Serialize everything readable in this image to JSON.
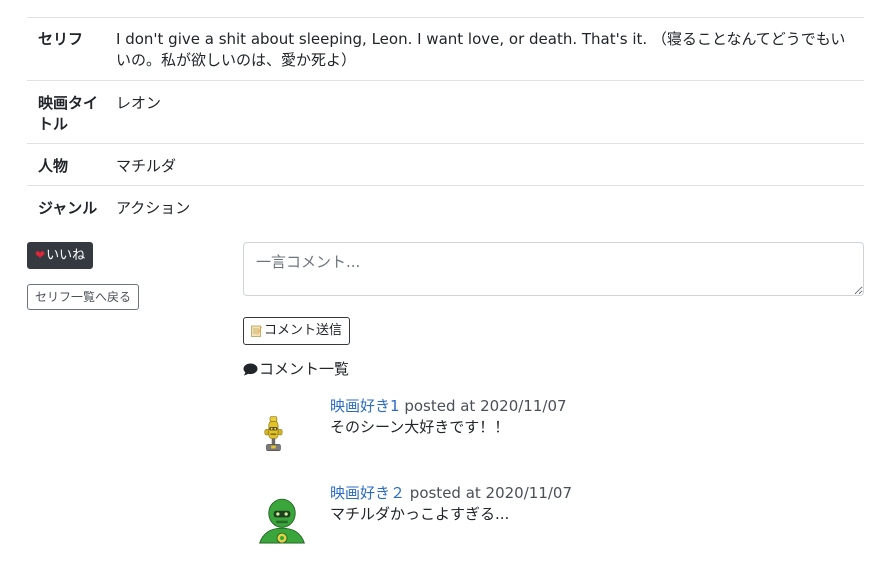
{
  "details": [
    {
      "label": "セリフ",
      "value": "I don't give a shit about sleeping, Leon. I want love, or death. That's it. （寝ることなんてどうでもいいの。私が欲しいのは、愛か死よ）"
    },
    {
      "label": "映画タイトル",
      "value": "レオン"
    },
    {
      "label": "人物",
      "value": "マチルダ"
    },
    {
      "label": "ジャンル",
      "value": "アクション"
    }
  ],
  "actions": {
    "like_label": "いいね",
    "back_label": "セリフ一覧へ戻る"
  },
  "comment_form": {
    "placeholder": "一言コメント...",
    "submit_label": "コメント送信"
  },
  "comments_heading": "コメント一覧",
  "comments": [
    {
      "user": "映画好き1",
      "posted": "posted at 2020/11/07",
      "text": "そのシーン大好きです！！",
      "avatar": "yellow-robot"
    },
    {
      "user": "映画好き２",
      "posted": "posted at 2020/11/07",
      "text": "マチルダかっこよすぎる...",
      "avatar": "green-robot"
    }
  ],
  "colors": {
    "link": "#2b6cc4",
    "dark_button": "#343a40",
    "heart": "#e0243a",
    "border": "#dee2e6"
  }
}
